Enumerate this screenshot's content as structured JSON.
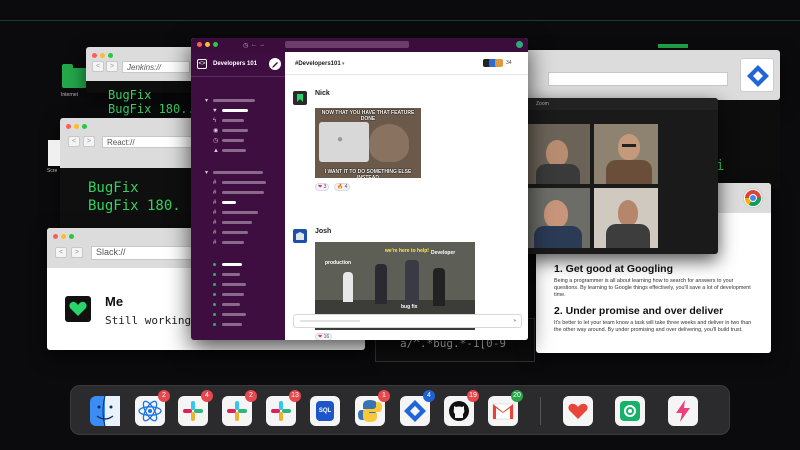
{
  "desktop": {
    "folder_label": "Internet",
    "screenshot_label": "Scre"
  },
  "windows": {
    "jenkins": {
      "url": "Jenkins://",
      "term_line1": "BugFix",
      "term_line2": "BugFix 180..."
    },
    "react": {
      "url": "React://",
      "term_line1": "BugFix",
      "term_line2": "BugFix 180."
    },
    "slack_browser": {
      "url": "Slack://",
      "name": "Me",
      "status": "Still working"
    },
    "regex_terminal": {
      "text": "a/^.*bug.*-1[0-9",
      "side_char": "i"
    }
  },
  "slack": {
    "workspace": "Developers 101",
    "channel": "#Developers101",
    "member_count": "34",
    "messages": [
      {
        "author": "Nick",
        "meme_top": "NOW THAT YOU HAVE THAT FEATURE DONE",
        "meme_bottom": "I WANT IT TO DO SOMETHING ELSE INSTEAD",
        "reactions": [
          {
            "emoji": "❤",
            "count": "3"
          },
          {
            "emoji": "🔥",
            "count": "4"
          }
        ]
      },
      {
        "author": "Josh",
        "gif_labels": {
          "left": "production",
          "center": "we're here to help!",
          "right": "Developer",
          "bottom": "bug fix"
        },
        "reactions": [
          {
            "emoji": "❤",
            "count": "16"
          }
        ]
      }
    ]
  },
  "video_call": {
    "title": "Zoom"
  },
  "article": {
    "heading1": "1. Get good at Googling",
    "para1": "Being a programmer is all about learning how to search for answers to your questions. By learning to Google things effectively, you'll save a lot of development time.",
    "heading2": "2. Under promise and over deliver",
    "para2": "It's better to let your team know a task will take three weeks and deliver in two than the other way around. By under promising and over delivering, you'll build trust."
  },
  "dock": {
    "items": [
      {
        "name": "Finder",
        "badge": ""
      },
      {
        "name": "React",
        "badge": "2"
      },
      {
        "name": "Slack",
        "badge": "4"
      },
      {
        "name": "Slack",
        "badge": "2"
      },
      {
        "name": "Slack",
        "badge": "13"
      },
      {
        "name": "SQL",
        "badge": ""
      },
      {
        "name": "Python",
        "badge": "1"
      },
      {
        "name": "Jira",
        "badge": "4"
      },
      {
        "name": "GitHub",
        "badge": "19"
      },
      {
        "name": "Gmail",
        "badge": "20"
      },
      {
        "name": "Heart app",
        "badge": ""
      },
      {
        "name": "Mail app",
        "badge": ""
      },
      {
        "name": "Bolt app",
        "badge": ""
      }
    ],
    "sql_label": "SQL"
  },
  "colors": {
    "terminal_green": "#36d060",
    "slack_sidebar": "#3f0e40",
    "slack_topbar": "#3b0d3c",
    "dock_bg": "#2b2b2e",
    "badge_red": "#e5484d"
  }
}
